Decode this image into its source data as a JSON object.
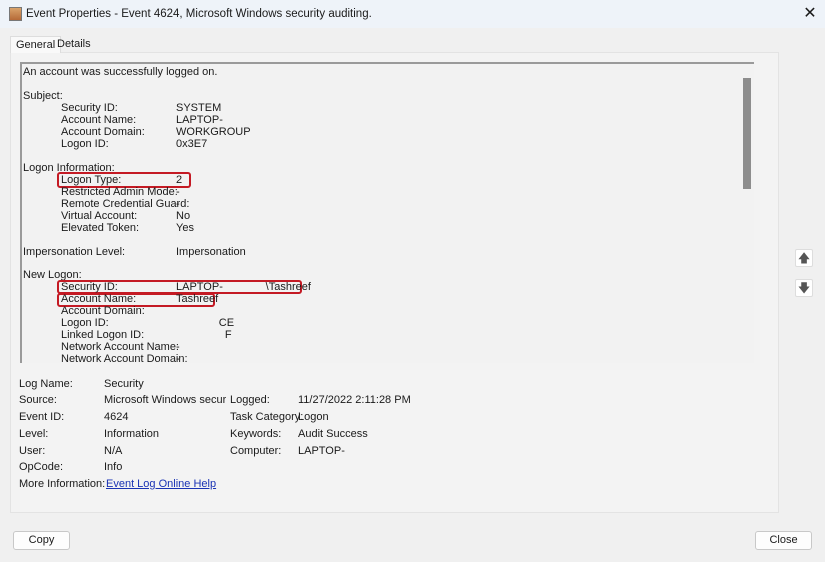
{
  "window": {
    "title": "Event Properties - Event 4624, Microsoft Windows security auditing.",
    "close": "✕"
  },
  "tabs": [
    "General",
    "Details"
  ],
  "description": {
    "intro": "An account was successfully logged on.",
    "subject": {
      "header": "Subject:",
      "rows": [
        [
          "Security ID:",
          "SYSTEM"
        ],
        [
          "Account Name:",
          "LAPTOP-"
        ],
        [
          "Account Domain:",
          "WORKGROUP"
        ],
        [
          "Logon ID:",
          "0x3E7"
        ]
      ]
    },
    "logon_info": {
      "header": "Logon Information:",
      "rows": [
        [
          "Logon Type:",
          "2"
        ],
        [
          "Restricted Admin Mode:",
          "-"
        ],
        [
          "Remote Credential Guard:",
          "-"
        ],
        [
          "Virtual Account:",
          "No"
        ],
        [
          "Elevated Token:",
          "Yes"
        ]
      ]
    },
    "impersonation": [
      "Impersonation Level:",
      "Impersonation"
    ],
    "new_logon": {
      "header": "New Logon:",
      "rows": [
        [
          "Security ID:",
          "LAPTOP-              \\Tashreef"
        ],
        [
          "Account Name:",
          "Tashreef"
        ],
        [
          "Account Domain:",
          ""
        ],
        [
          "Logon ID:",
          "              CE"
        ],
        [
          "Linked Logon ID:",
          "                F"
        ],
        [
          "Network Account Name:",
          "-"
        ],
        [
          "Network Account Domain:",
          "-"
        ]
      ]
    }
  },
  "fields": {
    "log_name": [
      "Log Name:",
      "Security"
    ],
    "source": [
      "Source:",
      "Microsoft Windows security a"
    ],
    "event_id": [
      "Event ID:",
      "4624"
    ],
    "level": [
      "Level:",
      "Information"
    ],
    "user": [
      "User:",
      "N/A"
    ],
    "opcode": [
      "OpCode:",
      "Info"
    ],
    "more_info": [
      "More Information:",
      "Event Log Online Help"
    ],
    "logged": [
      "Logged:",
      "11/27/2022 2:11:28 PM"
    ],
    "task_category": [
      "Task Category:",
      "Logon"
    ],
    "keywords": [
      "Keywords:",
      "Audit Success"
    ],
    "computer": [
      "Computer:",
      "LAPTOP-"
    ]
  },
  "buttons": {
    "copy": "Copy",
    "close": "Close",
    "up": "🡅",
    "down": "🡇"
  },
  "colors": {
    "highlight": "#c41a24",
    "link": "#1a33b4"
  }
}
